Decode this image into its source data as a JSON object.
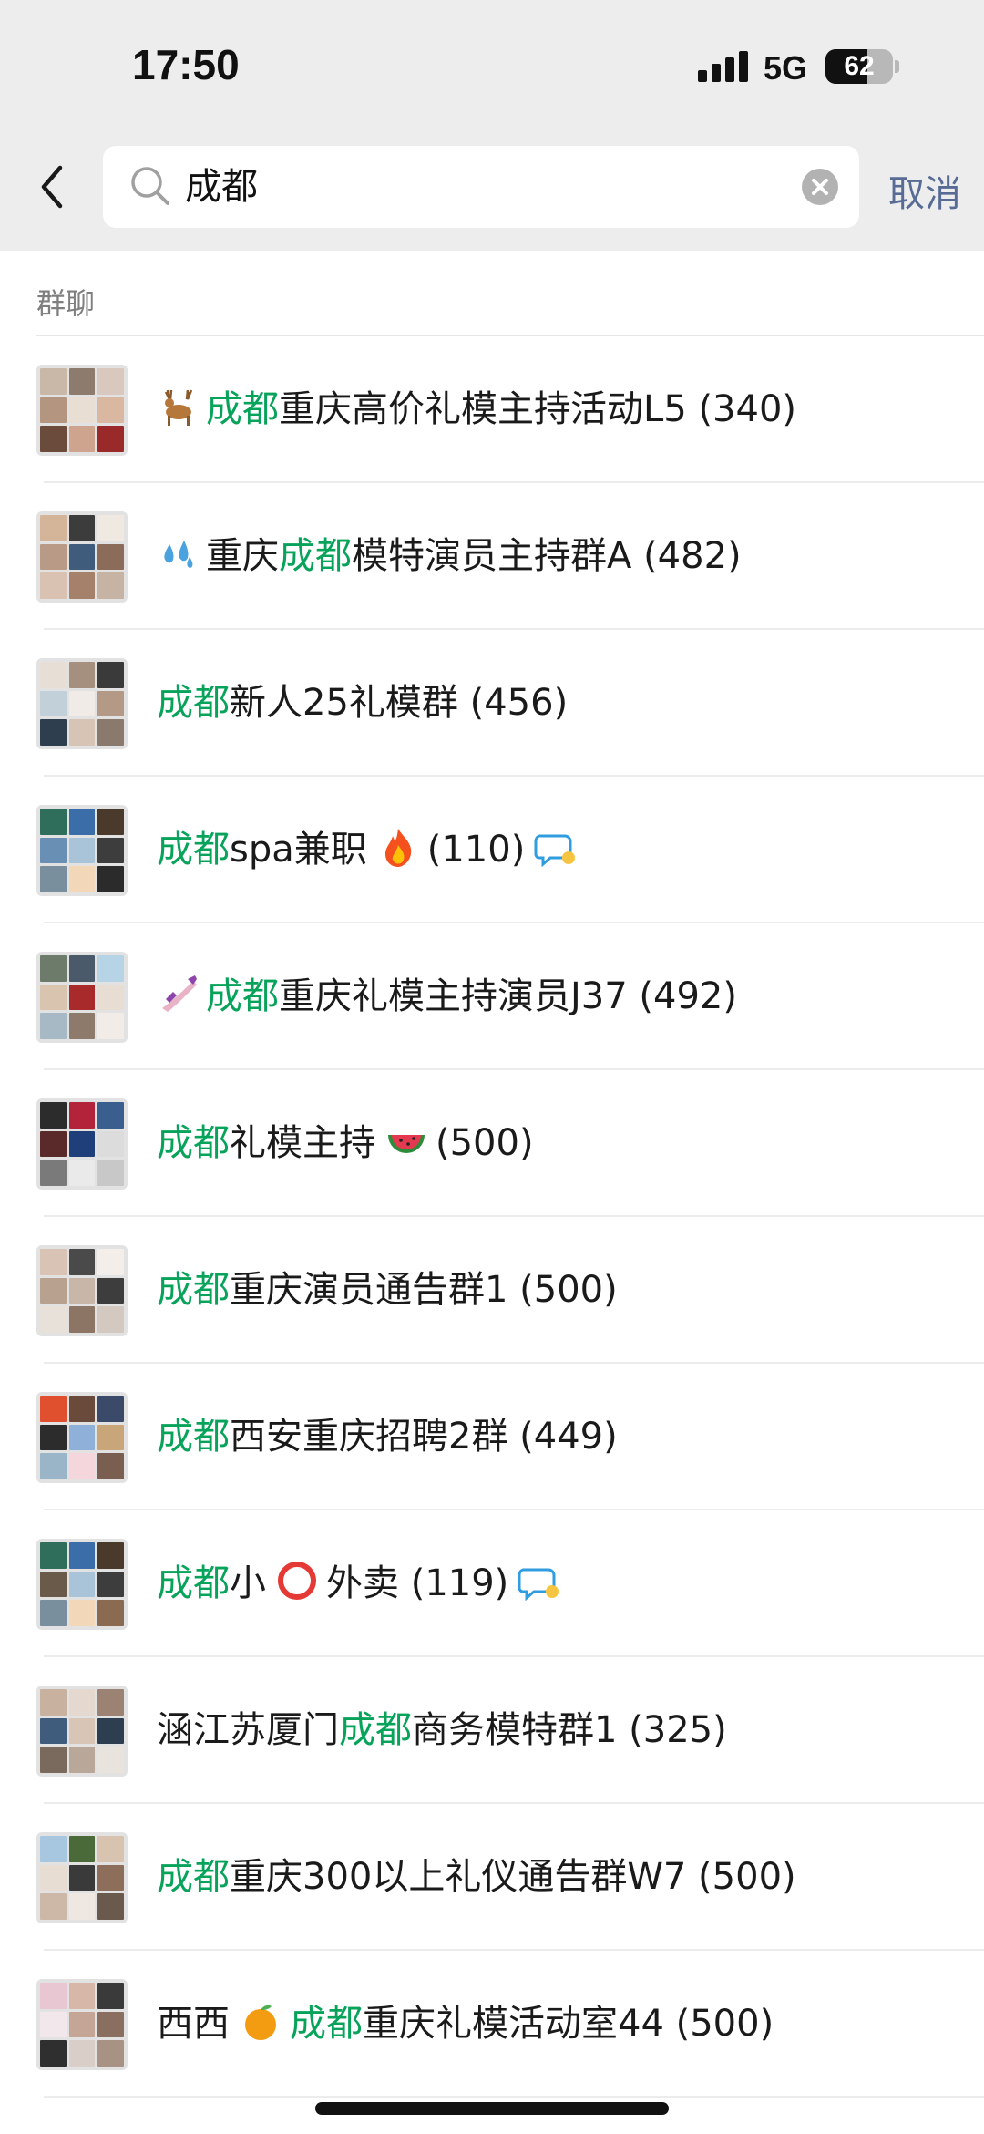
{
  "status_bar": {
    "time": "17:50",
    "network": "5G",
    "battery": "62",
    "battery_level": 0.62
  },
  "search": {
    "query": "成都",
    "cancel_label": "取消"
  },
  "section": {
    "label": "群聊"
  },
  "groups": [
    {
      "prefix_icon": "deer-emoji",
      "parts": [
        {
          "t": "成都",
          "hl": true
        },
        {
          "t": "重庆高价礼模主持活动L5 (340)",
          "hl": false
        }
      ],
      "suffix_icon": null,
      "colors": [
        "#c9b7a8",
        "#8d7c6e",
        "#d8c8bd",
        "#b39580",
        "#e9ded3",
        "#d9b7a0",
        "#6a4b3c",
        "#cfa48e",
        "#9a2a2a"
      ]
    },
    {
      "prefix_icon": "sweat-droplets-emoji",
      "parts": [
        {
          "t": "重庆",
          "hl": false
        },
        {
          "t": "成都",
          "hl": true
        },
        {
          "t": "模特演员主持群A (482)",
          "hl": false
        }
      ],
      "suffix_icon": null,
      "colors": [
        "#d4b59a",
        "#3c3c3c",
        "#efe9e1",
        "#b89a86",
        "#3f5c7d",
        "#8b6b5a",
        "#d9c2b2",
        "#a5806b",
        "#c7b3a4"
      ]
    },
    {
      "prefix_icon": null,
      "parts": [
        {
          "t": "成都",
          "hl": true
        },
        {
          "t": "新人25礼模群 (456)",
          "hl": false
        }
      ],
      "suffix_icon": null,
      "colors": [
        "#e7dfd6",
        "#a58f7e",
        "#3a3a3a",
        "#c2d0da",
        "#f0ebe6",
        "#b49a86",
        "#2f3e4e",
        "#d7c4b5",
        "#8a7a6e"
      ]
    },
    {
      "prefix_icon": null,
      "parts": [
        {
          "t": "成都",
          "hl": true
        },
        {
          "t": "spa兼职",
          "hl": false
        }
      ],
      "suffix_icon": "fire-emoji",
      "after_text": "(110)",
      "chat_icon": true,
      "colors": [
        "#2e6e5a",
        "#3b6ea8",
        "#4a3a2c",
        "#6a8fb4",
        "#a9c3d8",
        "#3d3d3d",
        "#7a8f9e",
        "#f2d8b8",
        "#2b2b2b"
      ]
    },
    {
      "prefix_icon": "nail-polish-emoji",
      "parts": [
        {
          "t": "成都",
          "hl": true
        },
        {
          "t": "重庆礼模主持演员J37 (492)",
          "hl": false
        }
      ],
      "suffix_icon": null,
      "colors": [
        "#6c7b6a",
        "#4a5a6a",
        "#b6d4e6",
        "#d9c4b0",
        "#a82a2a",
        "#e7ddd3",
        "#a7b9c4",
        "#8e7a6a",
        "#f1ece8"
      ]
    },
    {
      "prefix_icon": null,
      "parts": [
        {
          "t": "成都",
          "hl": true
        },
        {
          "t": "礼模主持",
          "hl": false
        }
      ],
      "suffix_icon": "watermelon-emoji",
      "after_text": "(500)",
      "colors": [
        "#2c2c2c",
        "#b3243a",
        "#3a5f8f",
        "#5a2a2a",
        "#1f3f7a",
        "#dcdcdc",
        "#7a7a7a",
        "#eaeaea",
        "#c8c8c8"
      ]
    },
    {
      "prefix_icon": null,
      "parts": [
        {
          "t": "成都",
          "hl": true
        },
        {
          "t": "重庆演员通告群1 (500)",
          "hl": false
        }
      ],
      "suffix_icon": null,
      "colors": [
        "#d9c3b5",
        "#4a4a4a",
        "#f3eee9",
        "#b9a190",
        "#c8b6a8",
        "#3d3d3d",
        "#e8e1da",
        "#8c7565",
        "#d3c9c1"
      ]
    },
    {
      "prefix_icon": null,
      "parts": [
        {
          "t": "成都",
          "hl": true
        },
        {
          "t": "西安重庆招聘2群 (449)",
          "hl": false
        }
      ],
      "suffix_icon": null,
      "colors": [
        "#e0502e",
        "#6a4a3a",
        "#3c4a6a",
        "#2c2c2c",
        "#8fb0d8",
        "#c9a57a",
        "#9ab4c8",
        "#f4d6dc",
        "#7a5f50"
      ]
    },
    {
      "prefix_icon": null,
      "parts": [
        {
          "t": "成都",
          "hl": true
        },
        {
          "t": "小",
          "hl": false
        }
      ],
      "mid_icon": "red-circle-emoji",
      "parts2": [
        {
          "t": "外卖 (119)",
          "hl": false
        }
      ],
      "chat_icon": true,
      "colors": [
        "#2e6e5a",
        "#3b6ea8",
        "#4a3a2c",
        "#6a5a4a",
        "#a9c3d8",
        "#3d3d3d",
        "#7a8f9e",
        "#f2d8b8",
        "#8a6a50"
      ]
    },
    {
      "prefix_icon": null,
      "parts": [
        {
          "t": "涵江苏厦门",
          "hl": false
        },
        {
          "t": "成都",
          "hl": true
        },
        {
          "t": "商务模特群1 (325)",
          "hl": false
        }
      ],
      "suffix_icon": null,
      "colors": [
        "#c9b1a0",
        "#e4d8cf",
        "#9c8272",
        "#3f5c7d",
        "#d8c5b6",
        "#2c3e50",
        "#7a6a5e",
        "#b9a79a",
        "#e9e3dd"
      ]
    },
    {
      "prefix_icon": null,
      "parts": [
        {
          "t": "成都",
          "hl": true
        },
        {
          "t": "重庆300以上礼仪通告群W7 (500)",
          "hl": false
        }
      ],
      "suffix_icon": null,
      "colors": [
        "#a7c7e0",
        "#4a6a3a",
        "#d8c2b0",
        "#e7ddd3",
        "#3a3a3a",
        "#8c6e5a",
        "#cdb8a8",
        "#efe8e2",
        "#6a5a4e"
      ]
    },
    {
      "prefix_icon": null,
      "parts": [
        {
          "t": "西西",
          "hl": false
        }
      ],
      "mid_icon": "tangerine-emoji",
      "parts2": [
        {
          "t": "成都",
          "hl": true
        },
        {
          "t": "重庆礼模活动室44 (500)",
          "hl": false
        }
      ],
      "suffix_icon": null,
      "colors": [
        "#e8c7d3",
        "#d7b8a8",
        "#3a3a3a",
        "#f2e8ec",
        "#c4a596",
        "#8a6f60",
        "#2f2f2f",
        "#d9cfc8",
        "#a89283"
      ]
    }
  ]
}
